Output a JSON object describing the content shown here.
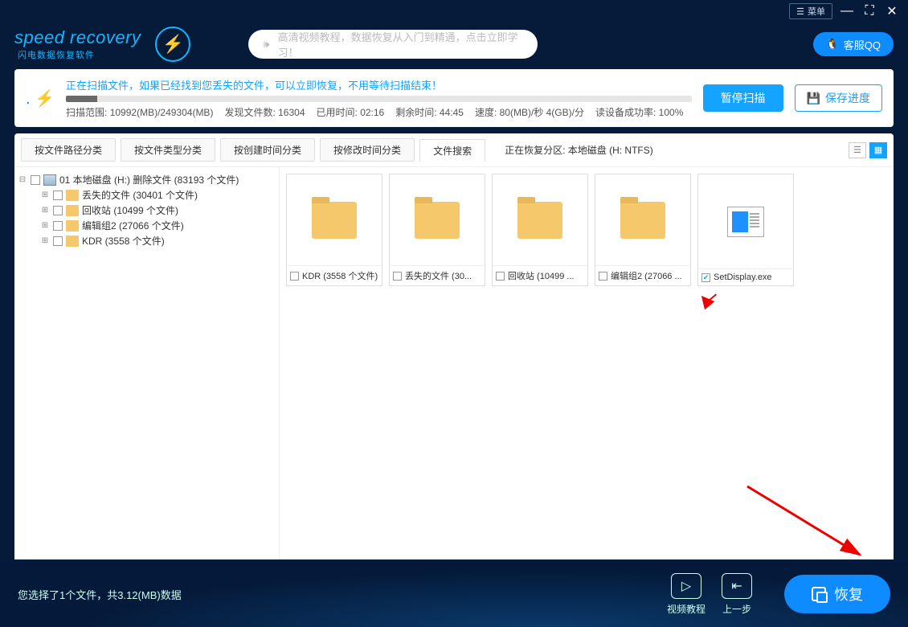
{
  "titlebar": {
    "menu": "菜单"
  },
  "header": {
    "logo_main": "speed recovery",
    "logo_sub": "闪电数据恢复软件",
    "tutorial": "高清视频教程，数据恢复从入门到精通，点击立即学习！",
    "qq": "客服QQ"
  },
  "status": {
    "message": "正在扫描文件，如果已经找到您丢失的文件，可以立即恢复，不用等待扫描结束！",
    "range_label": "扫描范围:",
    "range_value": "10992(MB)/249304(MB)",
    "found_label": "发现文件数:",
    "found_value": "16304",
    "elapsed_label": "已用时间:",
    "elapsed_value": "02:16",
    "remain_label": "剩余时间:",
    "remain_value": "44:45",
    "speed_label": "速度:",
    "speed_value": "80(MB)/秒  4(GB)/分",
    "success_label": "读设备成功率:",
    "success_value": "100%",
    "pause": "暂停扫描",
    "save": "保存进度"
  },
  "tabs": {
    "t0": "按文件路径分类",
    "t1": "按文件类型分类",
    "t2": "按创建时间分类",
    "t3": "按修改时间分类",
    "t4": "文件搜索",
    "partition": "正在恢复分区: 本地磁盘 (H: NTFS)"
  },
  "tree": {
    "root": "01 本地磁盘 (H:) 删除文件  (83193 个文件)",
    "n0": "丢失的文件    (30401 个文件)",
    "n1": "回收站    (10499 个文件)",
    "n2": "编辑组2    (27066 个文件)",
    "n3": "KDR    (3558 个文件)"
  },
  "tiles": {
    "t0": "KDR  (3558 个文件)",
    "t1": "丢失的文件  (30...",
    "t2": "回收站  (10499 ...",
    "t3": "编辑组2  (27066 ...",
    "t4": "SetDisplay.exe"
  },
  "footer": {
    "selection": "您选择了1个文件，共3.12(MB)数据",
    "video": "视频教程",
    "back": "上一步",
    "recover": "恢复"
  }
}
